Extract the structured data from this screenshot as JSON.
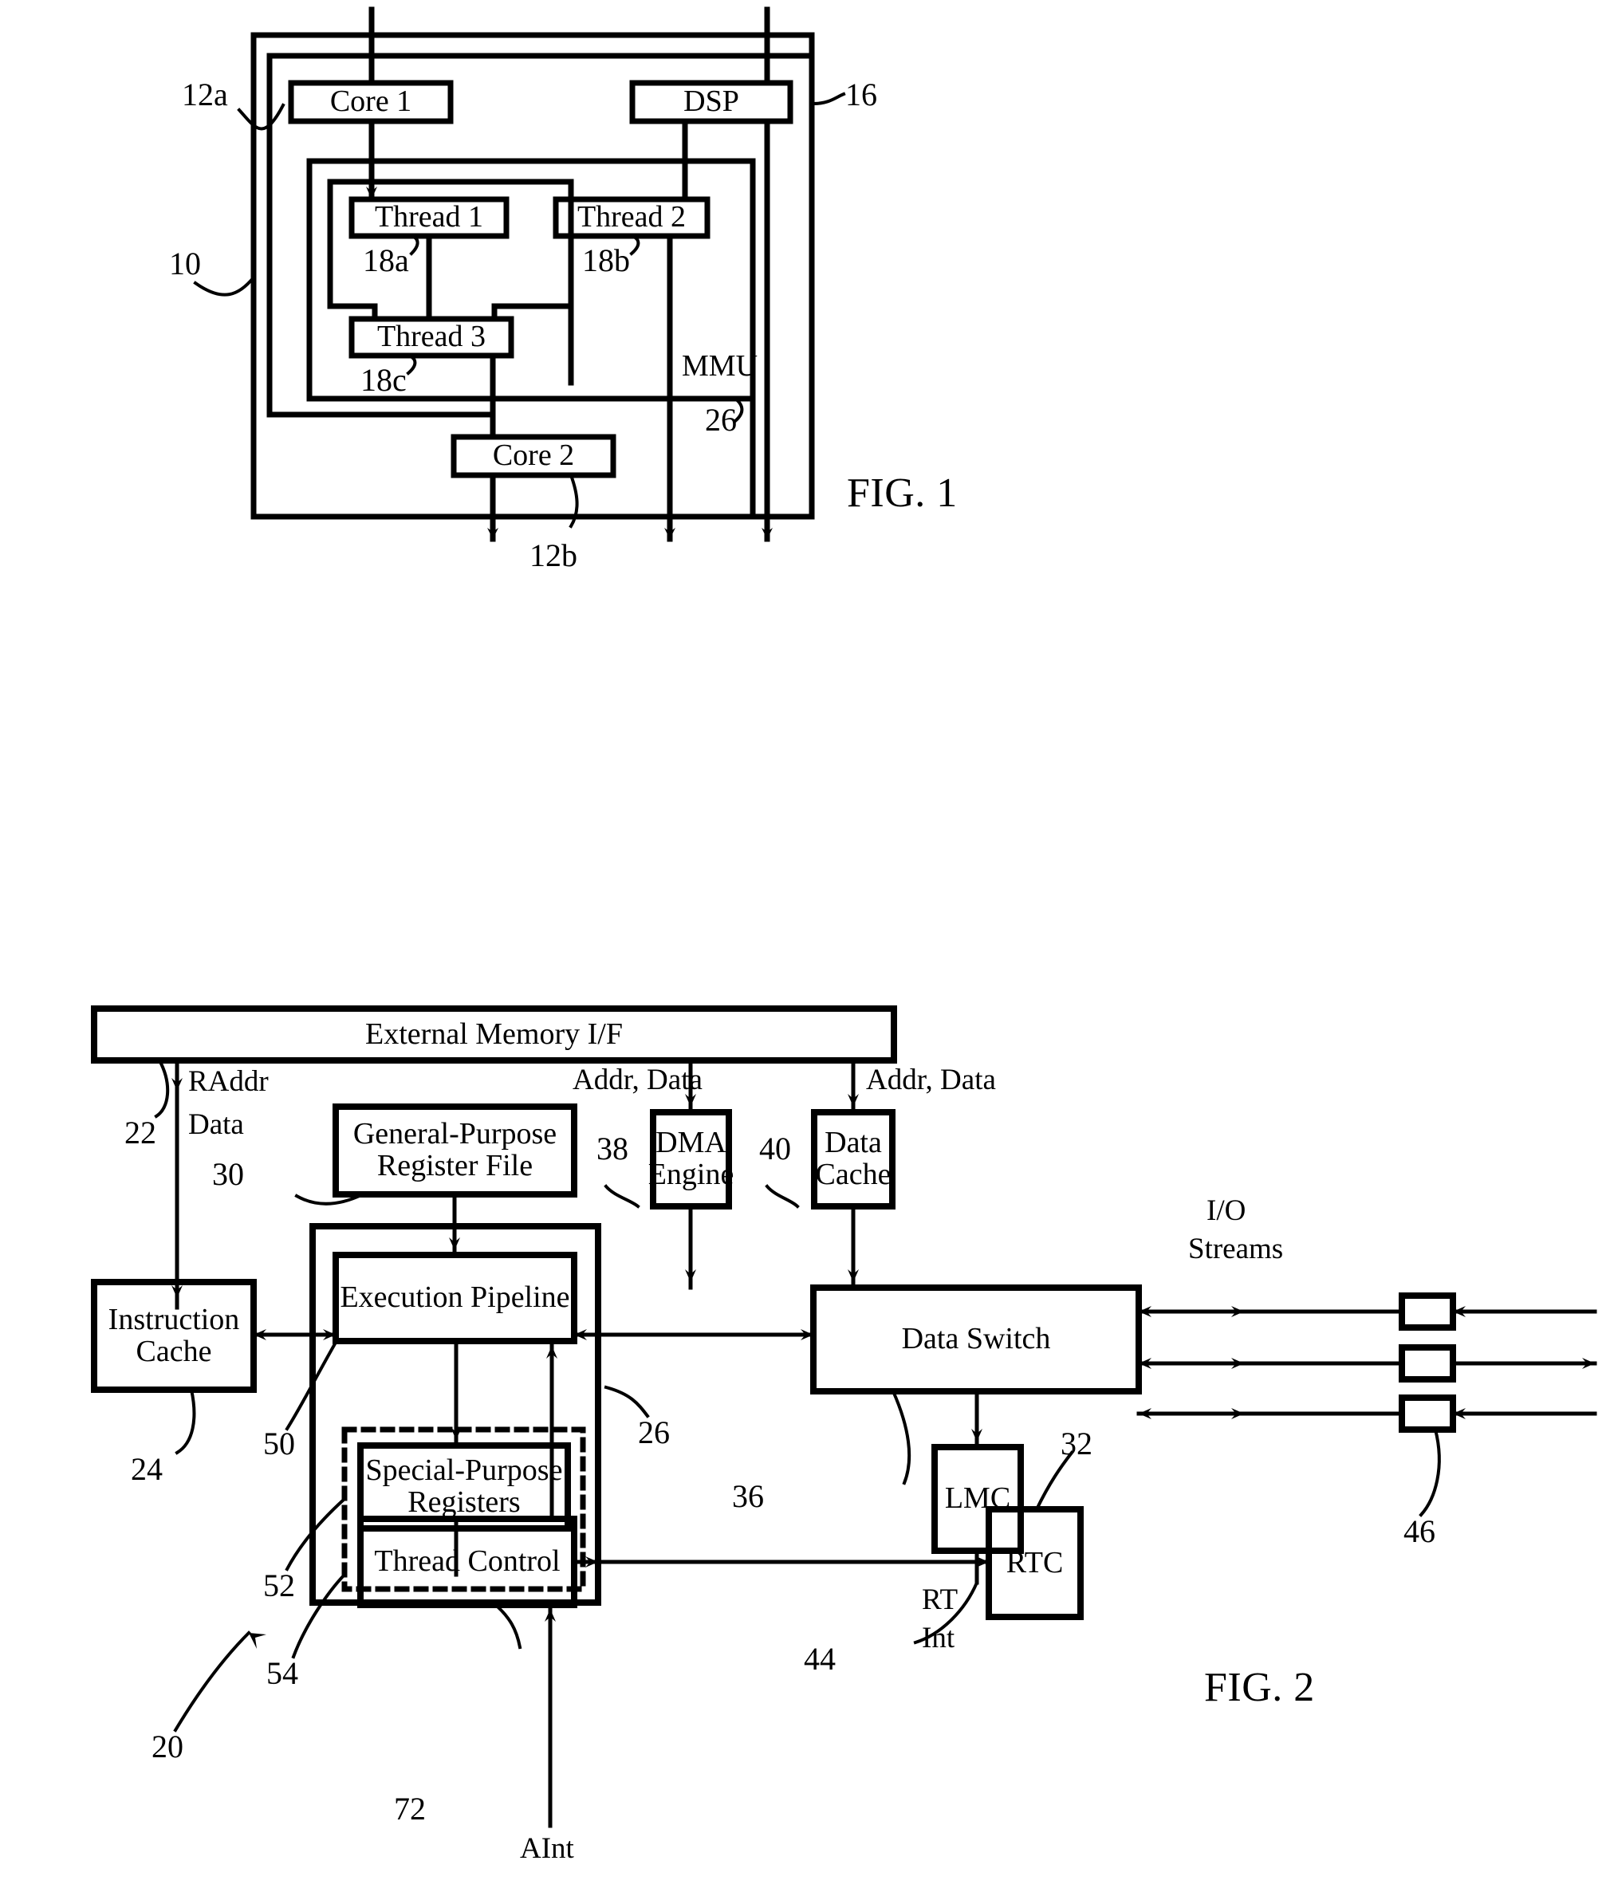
{
  "figure1": {
    "caption": "FIG. 1",
    "boxes": {
      "core1": "Core 1",
      "dsp": "DSP",
      "thread1": "Thread 1",
      "thread2": "Thread 2",
      "thread3": "Thread 3",
      "core2": "Core 2"
    },
    "mmu_label": "MMU",
    "ref_numbers": {
      "chip": "10",
      "core1": "12a",
      "core2": "12b",
      "dsp": "16",
      "thread1": "18a",
      "thread2": "18b",
      "thread3": "18c",
      "mmu": "26"
    }
  },
  "figure2": {
    "caption": "FIG. 2",
    "boxes": {
      "external_memory": "External Memory I/F",
      "register_file_line1": "General-Purpose",
      "register_file_line2": "Register File",
      "dma_line1": "DMA",
      "dma_line2": "Engine",
      "data_cache_line1": "Data",
      "data_cache_line2": "Cache",
      "instruction_cache_line1": "Instruction",
      "instruction_cache_line2": "Cache",
      "execution_pipeline": "Execution Pipeline",
      "data_switch": "Data Switch",
      "special_registers_line1": "Special-Purpose",
      "special_registers_line2": "Registers",
      "thread_control": "Thread Control",
      "rtc": "RTC",
      "lmc": "LMC"
    },
    "signal_labels": {
      "raddr": "RAddr",
      "data": "Data",
      "addr_data_1": "Addr, Data",
      "addr_data_2": "Addr, Data",
      "io_line1": "I/O",
      "io_line2": "Streams",
      "rt_line1": "RT",
      "rt_line2": "Int",
      "aint": "AInt"
    },
    "ref_numbers": {
      "system": "20",
      "external_memory": "22",
      "instruction_cache": "24",
      "core_boundary": "26",
      "register_file": "30",
      "rtc": "32",
      "data_switch": "36",
      "dma_engine": "38",
      "data_cache": "40",
      "lmc": "44",
      "io_ports": "46",
      "pipeline_group": "50",
      "special_registers": "52",
      "thread_control": "54",
      "dashed_boundary": "72"
    }
  },
  "style": {
    "ink": "#000000",
    "paper": "#ffffff"
  }
}
